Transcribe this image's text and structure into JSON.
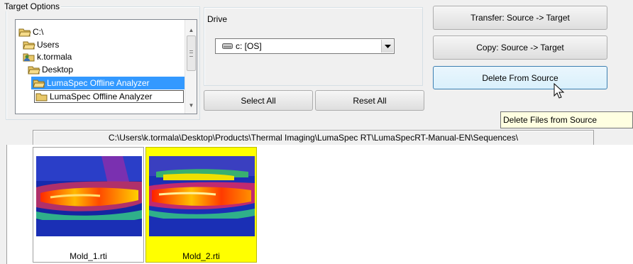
{
  "target_options": {
    "title": "Target Options",
    "tree": [
      {
        "label": "C:\\",
        "state": "normal"
      },
      {
        "label": "Users",
        "state": "normal"
      },
      {
        "label": "k.tormala",
        "state": "normal"
      },
      {
        "label": "Desktop",
        "state": "normal"
      },
      {
        "label": "LumaSpec Offline Analyzer",
        "state": "selected"
      },
      {
        "label": "LumaSpec Offline Analyzer",
        "state": "framed"
      }
    ]
  },
  "drive": {
    "title": "Drive",
    "selected": "c: [OS]"
  },
  "actions": {
    "select_all": "Select All",
    "reset_all": "Reset All",
    "transfer": "Transfer:  Source -> Target",
    "copy": "Copy:  Source -> Target",
    "delete": "Delete From Source"
  },
  "tooltip": "Delete Files from Source",
  "path": "C:\\Users\\k.tormala\\Desktop\\Products\\Thermal Imaging\\LumaSpec RT\\LumaSpecRT-Manual-EN\\Sequences\\",
  "thumbnails": [
    {
      "label": "Mold_1.rti",
      "selected": false
    },
    {
      "label": "Mold_2.rti",
      "selected": true
    }
  ],
  "colors": {
    "selection_blue": "#3399ff",
    "thumb_selected": "#ffff00",
    "tooltip_bg": "#ffffe1"
  }
}
